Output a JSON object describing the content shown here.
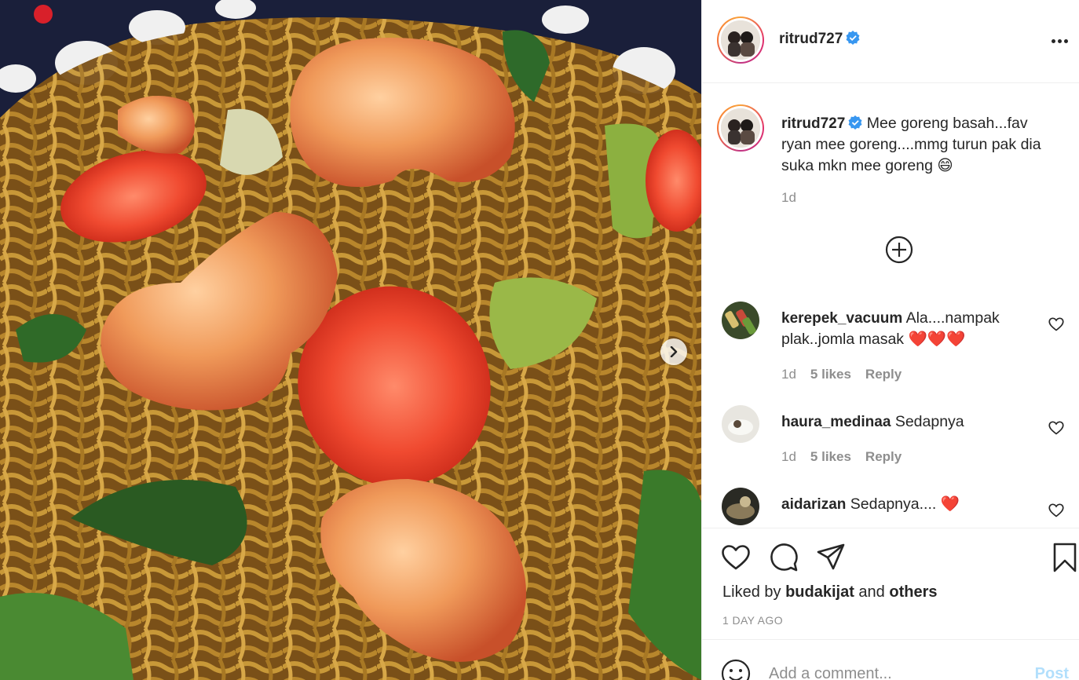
{
  "post": {
    "username": "ritrud727",
    "verified": true
  },
  "caption": {
    "username": "ritrud727",
    "text": "Mee goreng basah...fav ryan mee goreng....mmg turun pak dia suka mkn mee goreng",
    "emoji": "😄",
    "time": "1d"
  },
  "comments": [
    {
      "username": "kerepek_vacuum",
      "text": "Ala....nampak plak..jomla masak",
      "hearts": "❤️❤️❤️",
      "time": "1d",
      "likes": "5 likes",
      "reply": "Reply"
    },
    {
      "username": "haura_medinaa",
      "text": "Sedapnya",
      "hearts": "",
      "time": "1d",
      "likes": "5 likes",
      "reply": "Reply"
    },
    {
      "username": "aidarizan",
      "text": "Sedapnya....",
      "hearts": "❤️",
      "time": "",
      "likes": "",
      "reply": ""
    }
  ],
  "likes": {
    "prefix": "Liked by",
    "user": "budakijat",
    "joiner": "and",
    "others": "others"
  },
  "timestamp": "1 DAY AGO",
  "add_comment": {
    "placeholder": "Add a comment...",
    "post_label": "Post"
  },
  "colors": {
    "verified": "#3897f0",
    "heart_red": "#ed4956",
    "post_disabled": "#b2dffc",
    "muted": "#8e8e8e"
  },
  "icons": {
    "more": "more-options-icon",
    "add": "plus-circle-icon",
    "like": "heart-icon",
    "comment": "comment-bubble-icon",
    "share": "paper-plane-icon",
    "save": "bookmark-icon",
    "emoji": "emoji-icon",
    "next": "chevron-right-icon"
  }
}
